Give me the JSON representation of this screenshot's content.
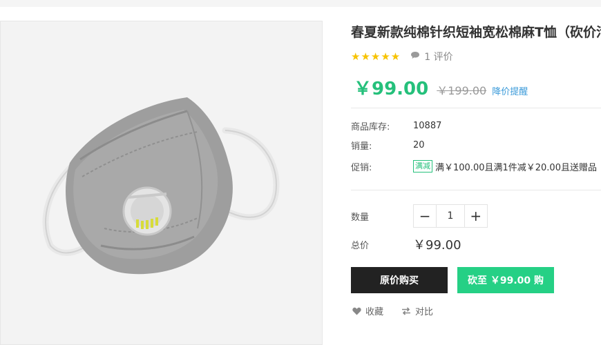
{
  "product": {
    "title": "春夏新款纯棉针织短袖宽松棉麻T恤（砍价活",
    "stars": "★★★★★",
    "review_count": "1 评价",
    "price": "￥99.00",
    "old_price": "￥199.00",
    "price_notify": "降价提醒",
    "rating_out_of_5": 5
  },
  "details": {
    "stock_label": "商品库存:",
    "stock_value": "10887",
    "sales_label": "销量:",
    "sales_value": "20",
    "promo_label": "促销:",
    "promo_tag": "满减",
    "promo_text": "满￥100.00且满1件减￥20.00且送赠品"
  },
  "purchase": {
    "qty_label": "数量",
    "qty_minus": "−",
    "qty_value": "1",
    "qty_plus": "+",
    "total_label": "总价",
    "total_value": "￥99.00",
    "buy_original": "原价购买",
    "buy_cut": "砍至 ￥99.00 购"
  },
  "actions": {
    "favorite": "收藏",
    "compare": "对比"
  },
  "colors": {
    "accent": "#25c07b",
    "button_dark": "#222222",
    "button_green": "#25d085",
    "star": "#f7c300",
    "link": "#3a9ad9"
  },
  "icons": [
    "star-icon",
    "comment-icon",
    "heart-icon",
    "compare-icon",
    "minus-icon",
    "plus-icon"
  ]
}
